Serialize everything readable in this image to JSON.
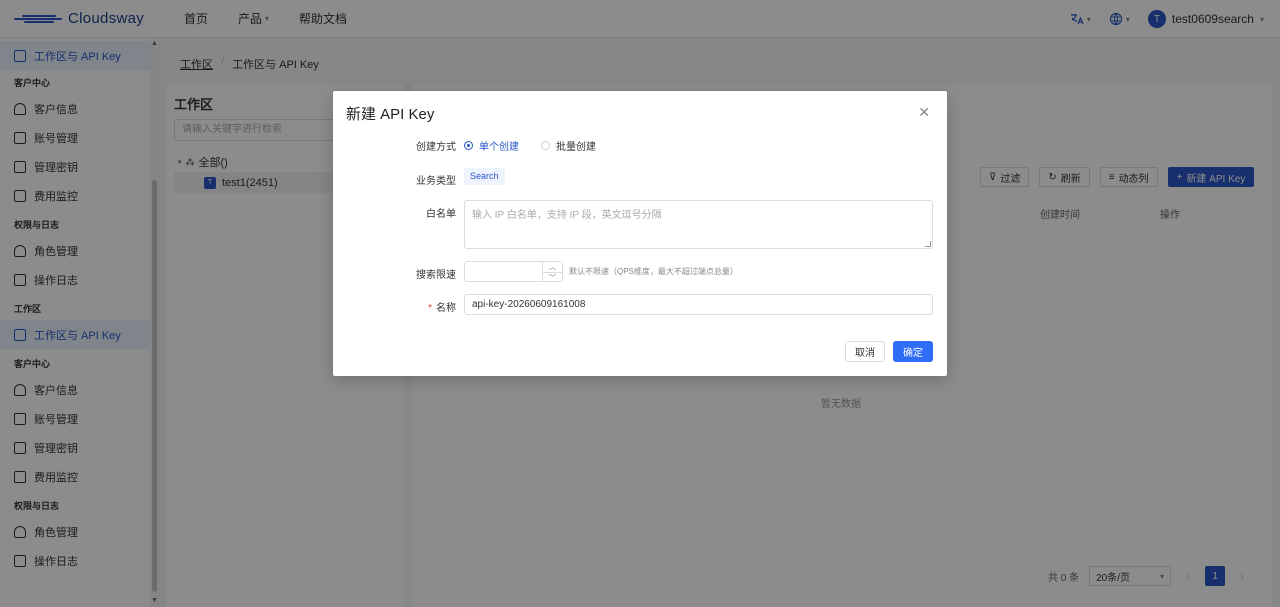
{
  "brand": {
    "name": "Cloudsway",
    "color": "#2a56c6"
  },
  "nav": {
    "home": "首页",
    "products": "产品",
    "docs": "帮助文档"
  },
  "top_right": {
    "translate_icon": "translate-icon",
    "theme_icon": "globe-icon",
    "avatar_letter": "T",
    "username": "test0609search"
  },
  "sidebar": {
    "top_item": "工作区与 API Key",
    "section_customer": "客户中心",
    "customer_items": [
      "客户信息",
      "账号管理",
      "管理密钥",
      "费用监控"
    ],
    "section_perm": "权限与日志",
    "perm_items": [
      "角色管理",
      "操作日志"
    ],
    "section_workspace": "工作区",
    "workspace_item": "工作区与 API Key",
    "section_customer2": "客户中心",
    "customer_items2": [
      "客户信息",
      "账号管理",
      "管理密钥",
      "费用监控"
    ],
    "section_perm2": "权限与日志",
    "perm_items2": [
      "角色管理",
      "操作日志"
    ]
  },
  "breadcrumb": {
    "root": "工作区",
    "sep": "/",
    "current": "工作区与 API Key"
  },
  "workspace": {
    "title": "工作区",
    "search_placeholder": "请输入关键字进行检索",
    "tree_root": "全部()",
    "tree_node_badge": "T",
    "tree_node": "test1(2451)"
  },
  "toolbar": {
    "filter": "过滤",
    "refresh": "刷新",
    "columns": "动态列",
    "new_key": "新建 API Key"
  },
  "table": {
    "headers": [
      "创建时间",
      "操作"
    ],
    "empty": "暂无数据"
  },
  "pager": {
    "total": "共 0 条",
    "page_size": "20条/页",
    "current_page": "1"
  },
  "modal": {
    "title": "新建 API Key",
    "create_mode_label": "创建方式",
    "create_mode_options": [
      "单个创建",
      "批量创建"
    ],
    "create_mode_selected": "单个创建",
    "biz_type_label": "业务类型",
    "biz_type_value": "Search",
    "whitelist_label": "白名单",
    "whitelist_placeholder": "输入 IP 白名单，支持 IP 段，英文逗号分隔",
    "rate_label": "搜索限速",
    "rate_value": "",
    "rate_hint": "默认不限速（QPS维度，最大不超过端点总量）",
    "name_required_mark": "*",
    "name_label": "名称",
    "name_value": "api-key-20260609161008",
    "cancel": "取消",
    "confirm": "确定"
  }
}
